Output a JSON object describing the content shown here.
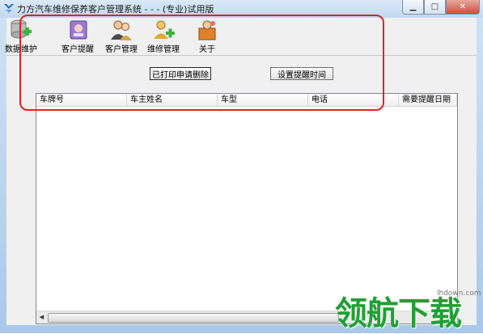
{
  "window": {
    "title": "力方汽车维修保养客户管理系统 - - - (专业)试用版",
    "minimize_glyph": "▁",
    "maximize_glyph": "□",
    "close_glyph": "✕"
  },
  "toolbar": {
    "items": [
      {
        "label": "数据维护",
        "icon": "database-icon"
      },
      {
        "label": "客户提醒",
        "icon": "reminder-icon"
      },
      {
        "label": "客户管理",
        "icon": "users-icon"
      },
      {
        "label": "维修管理",
        "icon": "repair-add-icon"
      },
      {
        "label": "关于",
        "icon": "about-icon"
      }
    ]
  },
  "actions": {
    "open_send": "已打印申请删除",
    "set_reminder_time": "设置提醒时间"
  },
  "table": {
    "columns": [
      "车牌号",
      "车主姓名",
      "车型",
      "电话",
      "需要提醒日期"
    ],
    "rows": []
  },
  "scrollbar": {
    "left_arrow": "◀",
    "right_arrow": "▶"
  },
  "watermark": {
    "text": "领航下载",
    "url": "lhdown.com"
  },
  "colors": {
    "highlight": "#e32222",
    "watermark": "#20a035"
  }
}
